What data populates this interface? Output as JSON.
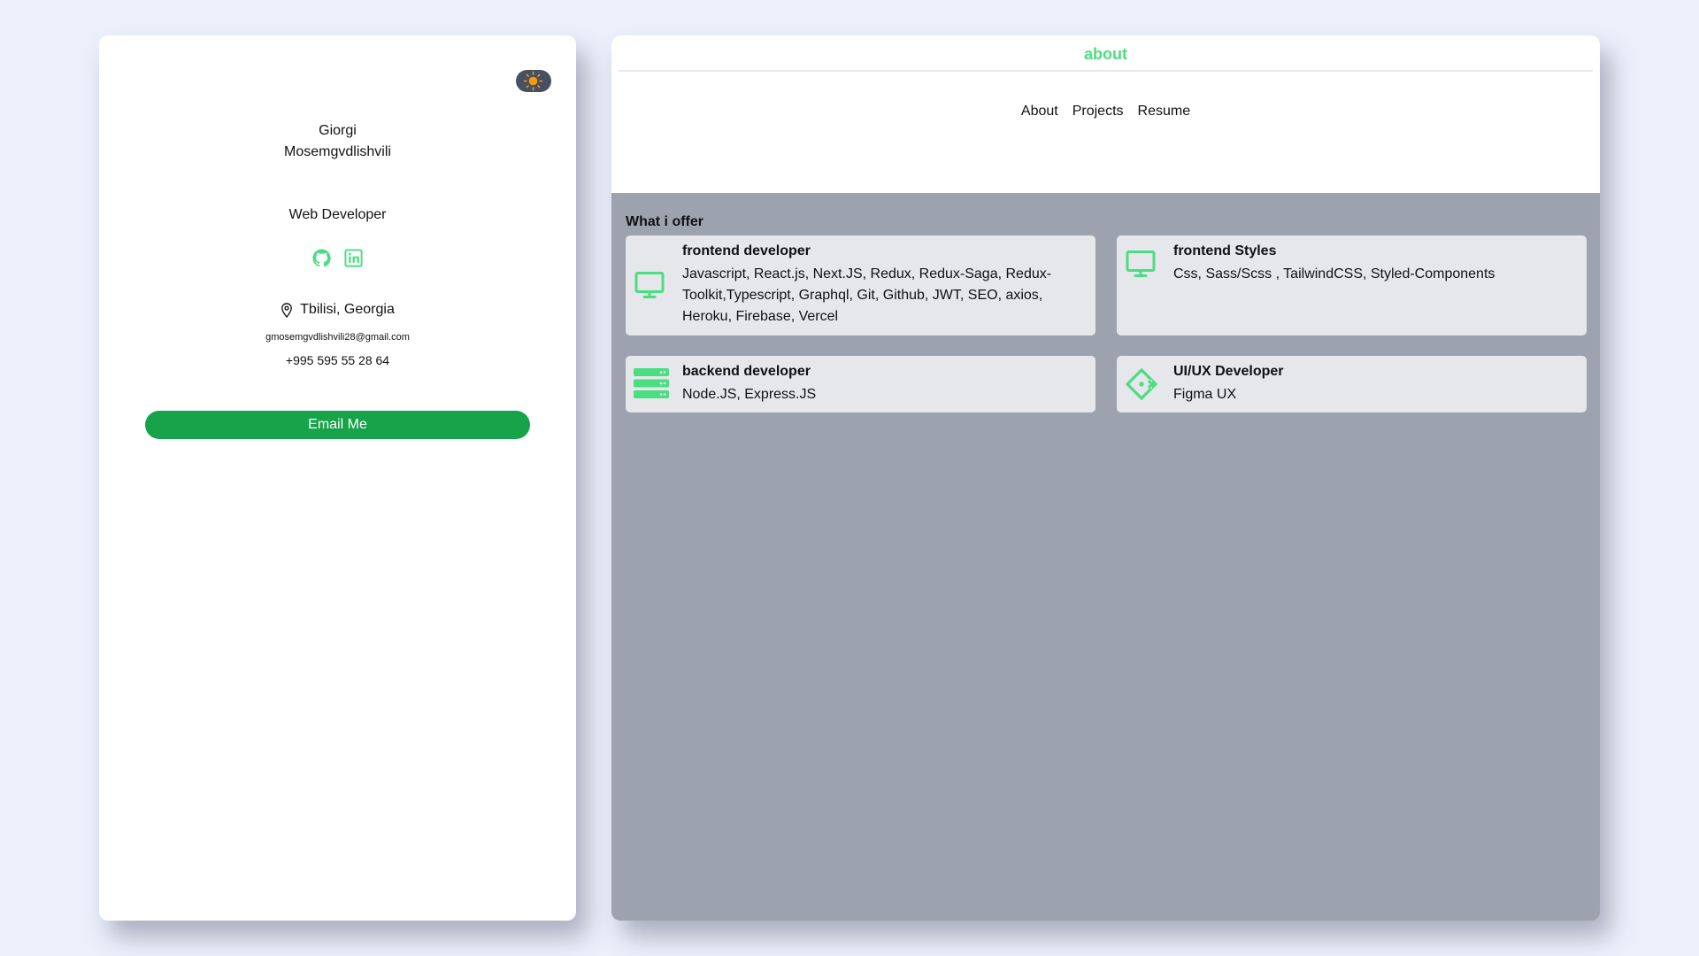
{
  "profile": {
    "first_name": "Giorgi",
    "last_name": "Mosemgvdlishvili",
    "title": "Web Developer",
    "location": "Tbilisi, Georgia",
    "email": "gmosemgvdlishvili28@gmail.com",
    "phone": "+995 595 55 28 64",
    "email_button_label": "Email Me",
    "socials": [
      {
        "icon": "github-icon"
      },
      {
        "icon": "linkedin-icon"
      }
    ]
  },
  "header": {
    "title": "about",
    "nav": [
      "About",
      "Projects",
      "Resume"
    ]
  },
  "offers": {
    "title": "What i offer",
    "items": [
      {
        "icon": "monitor-icon",
        "title": "frontend developer",
        "description": "Javascript, React.js, Next.JS, Redux, Redux-Saga, Redux-Toolkit,Typescript, Graphql, Git, Github, JWT, SEO, axios, Heroku, Firebase, Vercel"
      },
      {
        "icon": "monitor-icon",
        "title": "frontend Styles",
        "description": "Css, Sass/Scss , TailwindCSS, Styled-Components"
      },
      {
        "icon": "server-icon",
        "title": "backend developer",
        "description": "Node.JS, Express.JS"
      },
      {
        "icon": "figma-component-icon",
        "title": "UI/UX Developer",
        "description": "Figma UX"
      }
    ]
  },
  "theme": {
    "accent": "#4ade80",
    "button": "#16a34a",
    "toggle": "#475063",
    "sun": "#f59e0b",
    "panel": "#9ca3af",
    "card": "#e5e7eb"
  }
}
